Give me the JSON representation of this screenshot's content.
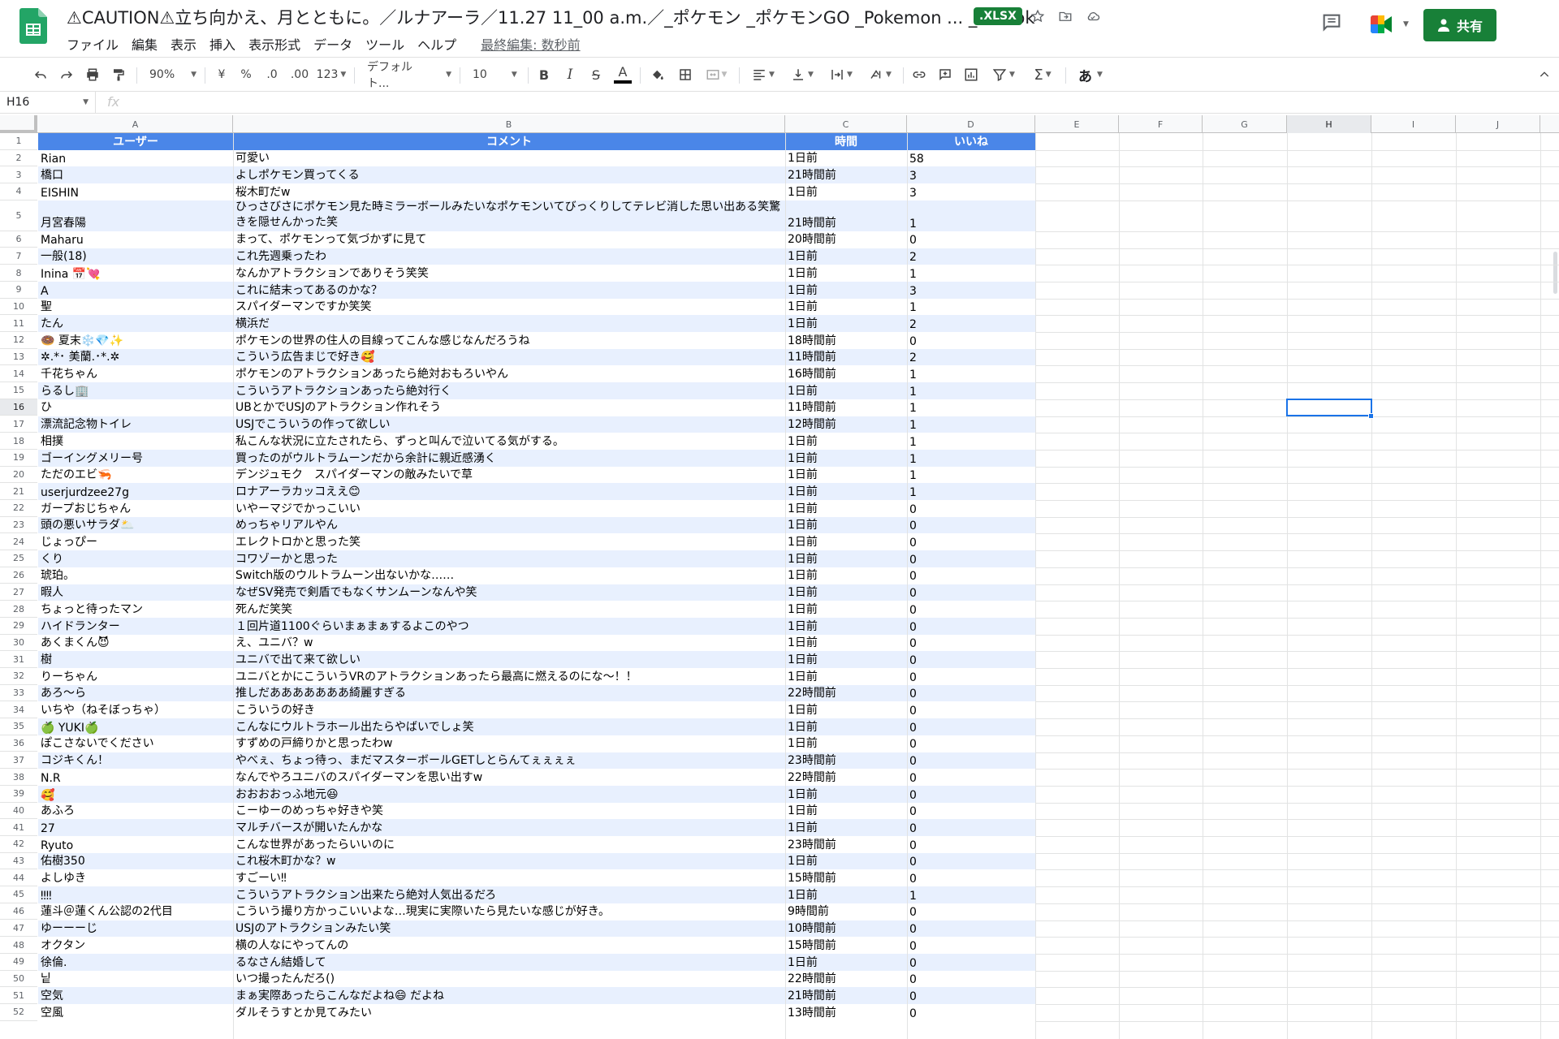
{
  "app": {
    "title": "⚠CAUTION⚠立ち向かえ、月とともに。／ルナアーラ／11.27 11_00 a.m.／_ポケモン _ポケモンGO _Pokemon ... _ TikTok",
    "file_badge": ".XLSX",
    "share_label": "共有",
    "last_edit": "最終編集: 数秒前"
  },
  "menu": [
    "ファイル",
    "編集",
    "表示",
    "挿入",
    "表示形式",
    "データ",
    "ツール",
    "ヘルプ"
  ],
  "toolbar": {
    "zoom": "90%",
    "currency": "¥",
    "percent": "%",
    "dec_less": ".0",
    "dec_more": ".00",
    "number_format": "123",
    "font": "デフォルト...",
    "font_size": "10",
    "input_tools": "あ"
  },
  "formula_bar": {
    "cell_ref": "H16",
    "fx": "fx",
    "value": ""
  },
  "columns": [
    "A",
    "B",
    "C",
    "D",
    "E",
    "F",
    "G",
    "H",
    "I",
    "J"
  ],
  "selected": {
    "column": "H",
    "row": "16"
  },
  "table": {
    "headers": [
      "ユーザー",
      "コメント",
      "時間",
      "いいね"
    ],
    "rows": [
      {
        "n": "2",
        "user": "Rian",
        "comment": "可愛い",
        "time": "1日前",
        "likes": "58"
      },
      {
        "n": "3",
        "user": "橋口",
        "comment": "よしポケモン買ってくる",
        "time": "21時間前",
        "likes": "3"
      },
      {
        "n": "4",
        "user": "EISHIN",
        "comment": "桜木町だw",
        "time": "1日前",
        "likes": "3"
      },
      {
        "n": "5",
        "user": "月宮春陽",
        "comment": "ひっさびさにポケモン見た時ミラーボールみたいなポケモンいてびっくりしてテレビ消した思い出ある笑驚きを隠せんかった笑",
        "time": "21時間前",
        "likes": "1"
      },
      {
        "n": "6",
        "user": "Maharu",
        "comment": "まって、ポケモンって気づかずに見て",
        "time": "20時間前",
        "likes": "0"
      },
      {
        "n": "7",
        "user": "一般(18)",
        "comment": "これ先週乗ったわ",
        "time": "1日前",
        "likes": "2"
      },
      {
        "n": "8",
        "user": "Inina 📅💘",
        "comment": "なんかアトラクションでありそう笑笑",
        "time": "1日前",
        "likes": "1"
      },
      {
        "n": "9",
        "user": "A",
        "comment": "これに結末ってあるのかな？",
        "time": "1日前",
        "likes": "3"
      },
      {
        "n": "10",
        "user": "聖",
        "comment": "スパイダーマンですか笑笑",
        "time": "1日前",
        "likes": "1"
      },
      {
        "n": "11",
        "user": "たん",
        "comment": "横浜だ",
        "time": "1日前",
        "likes": "2"
      },
      {
        "n": "12",
        "user": "🍩 夏末❄️💎✨",
        "comment": "ポケモンの世界の住人の目線ってこんな感じなんだろうね",
        "time": "18時間前",
        "likes": "0"
      },
      {
        "n": "13",
        "user": "✲.*･ 美蘭.･*.✲",
        "comment": "こういう広告まじで好き🥰",
        "time": "11時間前",
        "likes": "2"
      },
      {
        "n": "14",
        "user": "千花ちゃん",
        "comment": "ポケモンのアトラクションあったら絶対おもろいやん",
        "time": "16時間前",
        "likes": "1"
      },
      {
        "n": "15",
        "user": "らるし🏢",
        "comment": "こういうアトラクションあったら絶対行く",
        "time": "1日前",
        "likes": "1"
      },
      {
        "n": "16",
        "user": "ひ",
        "comment": "UBとかでUSJのアトラクション作れそう",
        "time": "11時間前",
        "likes": "1"
      },
      {
        "n": "17",
        "user": "漂流記念物トイレ",
        "comment": "USJでこういうの作って欲しい",
        "time": "12時間前",
        "likes": "1"
      },
      {
        "n": "18",
        "user": "相撲",
        "comment": "私こんな状況に立たされたら、ずっと叫んで泣いてる気がする。",
        "time": "1日前",
        "likes": "1"
      },
      {
        "n": "19",
        "user": "ゴーイングメリー号",
        "comment": "買ったのがウルトラムーンだから余計に親近感湧く",
        "time": "1日前",
        "likes": "1"
      },
      {
        "n": "20",
        "user": "ただのエビ🦐",
        "comment": "デンジュモク　スパイダーマンの敵みたいで草",
        "time": "1日前",
        "likes": "1"
      },
      {
        "n": "21",
        "user": "userjurdzee27g",
        "comment": "ロナアーラカッコええ😊",
        "time": "1日前",
        "likes": "1"
      },
      {
        "n": "22",
        "user": "ガープおじちゃん",
        "comment": "いやーマジでかっこいい",
        "time": "1日前",
        "likes": "0"
      },
      {
        "n": "23",
        "user": "頭の悪いサラダ🌥️",
        "comment": "めっちゃリアルやん",
        "time": "1日前",
        "likes": "0"
      },
      {
        "n": "24",
        "user": "じょっぴー",
        "comment": "エレクトロかと思った笑",
        "time": "1日前",
        "likes": "0"
      },
      {
        "n": "25",
        "user": "くり",
        "comment": "コワゾーかと思った",
        "time": "1日前",
        "likes": "0"
      },
      {
        "n": "26",
        "user": "琥珀。",
        "comment": "Switch版のウルトラムーン出ないかな……",
        "time": "1日前",
        "likes": "0"
      },
      {
        "n": "27",
        "user": "暇人",
        "comment": "なぜSV発売で剣盾でもなくサンムーンなんや笑",
        "time": "1日前",
        "likes": "0"
      },
      {
        "n": "28",
        "user": "ちょっと待ったマン",
        "comment": "死んだ笑笑",
        "time": "1日前",
        "likes": "0"
      },
      {
        "n": "29",
        "user": "ハイドランター",
        "comment": "１回片道1100ぐらいまぁまぁするよこのやつ",
        "time": "1日前",
        "likes": "0"
      },
      {
        "n": "30",
        "user": "あくまくん😈",
        "comment": "え、ユニバ？w",
        "time": "1日前",
        "likes": "0"
      },
      {
        "n": "31",
        "user": "樹",
        "comment": "ユニバで出て来て欲しい",
        "time": "1日前",
        "likes": "0"
      },
      {
        "n": "32",
        "user": "りーちゃん",
        "comment": "ユニバとかにこういうVRのアトラクションあったら最高に燃えるのにな〜！！",
        "time": "1日前",
        "likes": "0"
      },
      {
        "n": "33",
        "user": "あろ〜ら",
        "comment": "推しだあああああああ綺麗すぎる",
        "time": "22時間前",
        "likes": "0"
      },
      {
        "n": "34",
        "user": "いちや（ねそぼっちゃ）",
        "comment": "こういうの好き",
        "time": "1日前",
        "likes": "0"
      },
      {
        "n": "35",
        "user": "🍏 YUKI🍏",
        "comment": "こんなにウルトラホール出たらやばいでしょ笑",
        "time": "1日前",
        "likes": "0"
      },
      {
        "n": "36",
        "user": "ぽこさないでください",
        "comment": "すずめの戸締りかと思ったわw",
        "time": "1日前",
        "likes": "0"
      },
      {
        "n": "37",
        "user": "コジキくん！",
        "comment": "やべぇ、ちょっ待っ、まだマスターボールGETしとらんてぇぇぇぇ",
        "time": "23時間前",
        "likes": "0"
      },
      {
        "n": "38",
        "user": "N.R",
        "comment": "なんでやろユニバのスパイダーマンを思い出すw",
        "time": "22時間前",
        "likes": "0"
      },
      {
        "n": "39",
        "user": "🥰",
        "comment": "おおおおっふ地元😆",
        "time": "1日前",
        "likes": "0"
      },
      {
        "n": "40",
        "user": "あふろ",
        "comment": "こーゆーのめっちゃ好きや笑",
        "time": "1日前",
        "likes": "0"
      },
      {
        "n": "41",
        "user": "27",
        "comment": "マルチバースが開いたんかな",
        "time": "1日前",
        "likes": "0"
      },
      {
        "n": "42",
        "user": "Ryuto",
        "comment": "こんな世界があったらいいのに",
        "time": "23時間前",
        "likes": "0"
      },
      {
        "n": "43",
        "user": "佑樹350",
        "comment": "これ桜木町かな？w",
        "time": "1日前",
        "likes": "0"
      },
      {
        "n": "44",
        "user": "よしゆき",
        "comment": "すごーい‼",
        "time": "15時間前",
        "likes": "0"
      },
      {
        "n": "45",
        "user": "‼‼",
        "comment": "こういうアトラクション出来たら絶対人気出るだろ",
        "time": "1日前",
        "likes": "1"
      },
      {
        "n": "46",
        "user": "蓮斗＠蓮くん公認の2代目",
        "comment": "こういう撮り方かっこいいよな…現実に実際いたら見たいな感じが好き。",
        "time": "9時間前",
        "likes": "0"
      },
      {
        "n": "47",
        "user": "ゆーーーじ",
        "comment": "USJのアトラクションみたい笑",
        "time": "10時間前",
        "likes": "0"
      },
      {
        "n": "48",
        "user": "オクタン",
        "comment": "横の人なにやってんの",
        "time": "15時間前",
        "likes": "0"
      },
      {
        "n": "49",
        "user": "徐倫.",
        "comment": "るなさん結婚して",
        "time": "1日前",
        "likes": "0"
      },
      {
        "n": "50",
        "user": "닡",
        "comment": "いつ撮ったんだろ()",
        "time": "22時間前",
        "likes": "0"
      },
      {
        "n": "51",
        "user": "空気",
        "comment": "まぁ実際あったらこんなだよね😄 だよね",
        "time": "21時間前",
        "likes": "0"
      },
      {
        "n": "52",
        "user": "空風",
        "comment": "ダルそうすとか見てみたい",
        "time": "13時間前",
        "likes": "0"
      }
    ]
  }
}
